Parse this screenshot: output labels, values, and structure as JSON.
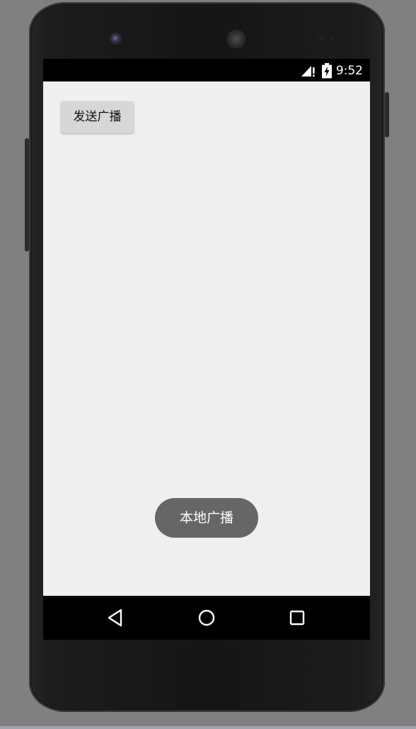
{
  "status_bar": {
    "time": "9:52",
    "signal_icon": "signal-no-sim-icon",
    "battery_icon": "battery-charging-icon"
  },
  "main": {
    "send_button_label": "发送广播"
  },
  "toast": {
    "text": "本地广播"
  },
  "nav_bar": {
    "back_icon": "back-triangle-icon",
    "home_icon": "home-circle-icon",
    "recents_icon": "recents-square-icon"
  },
  "colors": {
    "app_background": "#efefef",
    "button_background": "#d6d7d7",
    "toast_background": "#666666",
    "bars": "#000000",
    "device_frame": "#1a1a1a",
    "backdrop": "#808080"
  }
}
